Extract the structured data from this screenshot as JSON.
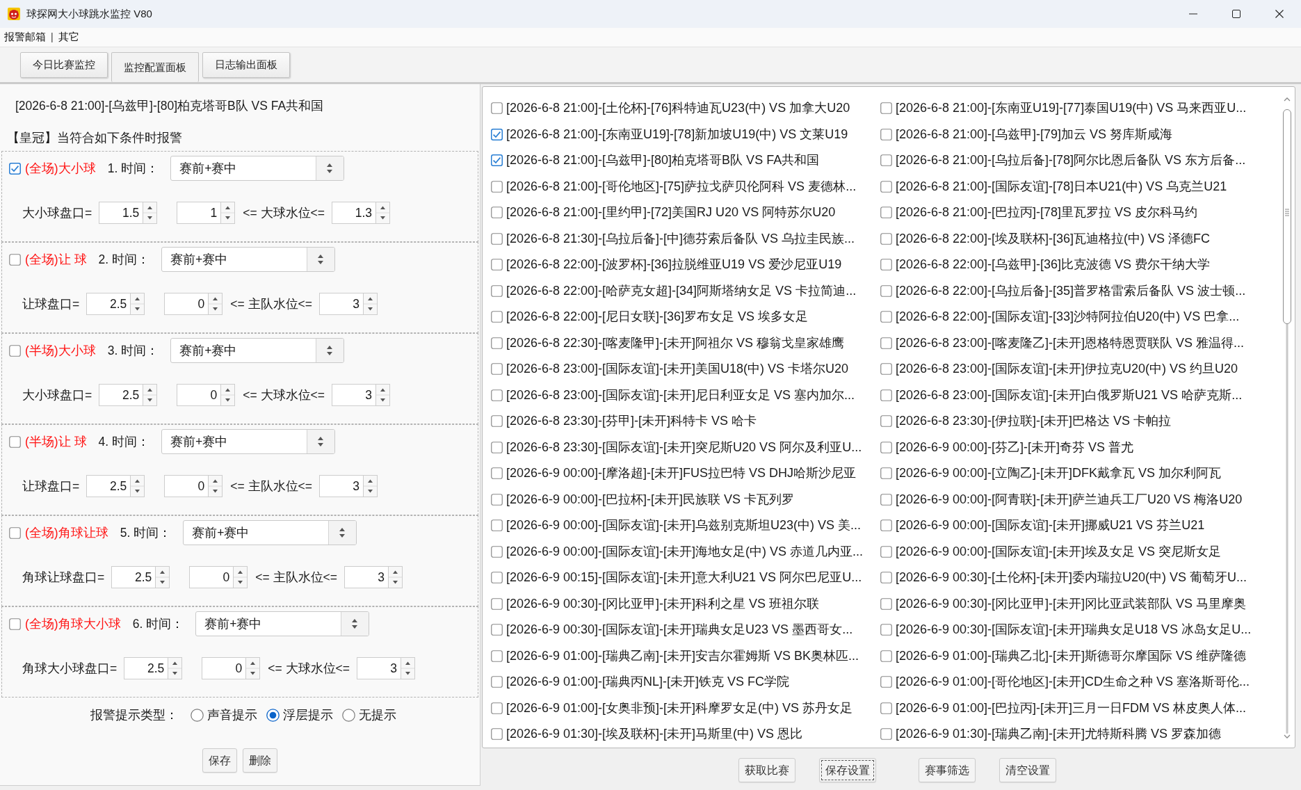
{
  "window": {
    "title": "球探网大小球跳水监控 V80"
  },
  "menu": [
    {
      "label": "报警邮箱",
      "kind": "item"
    },
    {
      "label": "|",
      "kind": "separator"
    },
    {
      "label": "其它",
      "kind": "item"
    }
  ],
  "tabs": [
    {
      "label": "今日比赛监控",
      "selected": false
    },
    {
      "label": "监控配置面板",
      "selected": true
    },
    {
      "label": "日志输出面板",
      "selected": false
    }
  ],
  "config": {
    "match": "[2026-6-8 21:00]-[乌兹甲]-[80]柏克塔哥B队 VS FA共和国",
    "heading": "【皇冠】当符合如下条件时报警",
    "rules": [
      {
        "checked": true,
        "label": "(全场)大小球",
        "time_label": "1. 时间：",
        "time_value": "赛前+赛中",
        "line_label": "大小球盘口=",
        "line_value": "1.5",
        "min_value": "1",
        "range_label": "<= 大球水位<=",
        "max_value": "1.3"
      },
      {
        "checked": false,
        "label": "(全场)让 球",
        "time_label": "2. 时间：",
        "time_value": "赛前+赛中",
        "line_label": "让球盘口=",
        "line_value": "2.5",
        "min_value": "0",
        "range_label": "<= 主队水位<=",
        "max_value": "3"
      },
      {
        "checked": false,
        "label": "(半场)大小球",
        "time_label": "3. 时间：",
        "time_value": "赛前+赛中",
        "line_label": "大小球盘口=",
        "line_value": "2.5",
        "min_value": "0",
        "range_label": "<= 大球水位<=",
        "max_value": "3"
      },
      {
        "checked": false,
        "label": "(半场)让 球",
        "time_label": "4. 时间：",
        "time_value": "赛前+赛中",
        "line_label": "让球盘口=",
        "line_value": "2.5",
        "min_value": "0",
        "range_label": "<= 主队水位<=",
        "max_value": "3"
      },
      {
        "checked": false,
        "label": "(全场)角球让球",
        "time_label": "5. 时间：",
        "time_value": "赛前+赛中",
        "line_label": "角球让球盘口=",
        "line_value": "2.5",
        "min_value": "0",
        "range_label": "<= 主队水位<=",
        "max_value": "3"
      },
      {
        "checked": false,
        "label": "(全场)角球大小球",
        "time_label": "6. 时间：",
        "time_value": "赛前+赛中",
        "line_label": "角球大小球盘口=",
        "line_value": "2.5",
        "min_value": "0",
        "range_label": "<= 大球水位<=",
        "max_value": "3"
      }
    ],
    "alert_type": {
      "label": "报警提示类型：",
      "options": [
        {
          "label": "声音提示",
          "selected": false
        },
        {
          "label": "浮层提示",
          "selected": true
        },
        {
          "label": "无提示",
          "selected": false
        }
      ]
    },
    "buttons": [
      {
        "label": "保存"
      },
      {
        "label": "删除"
      }
    ]
  },
  "matches": [
    {
      "text": "[2026-6-8 21:00]-[土伦杯]-[76]科特迪瓦U23(中) VS 加拿大U20",
      "checked": false
    },
    {
      "text": "[2026-6-8 21:00]-[东南亚U19]-[78]新加坡U19(中) VS 文莱U19",
      "checked": true
    },
    {
      "text": "[2026-6-8 21:00]-[乌兹甲]-[80]柏克塔哥B队 VS FA共和国",
      "checked": true
    },
    {
      "text": "[2026-6-8 21:00]-[哥伦地区]-[75]萨拉戈萨贝伦阿科 VS 麦德林...",
      "checked": false
    },
    {
      "text": "[2026-6-8 21:00]-[里约甲]-[72]美国RJ U20 VS 阿特苏尔U20",
      "checked": false
    },
    {
      "text": "[2026-6-8 21:30]-[乌拉后备]-[中]德芬索后备队 VS 乌拉圭民族...",
      "checked": false
    },
    {
      "text": "[2026-6-8 22:00]-[波罗杯]-[36]拉脱维亚U19 VS 爱沙尼亚U19",
      "checked": false
    },
    {
      "text": "[2026-6-8 22:00]-[哈萨克女超]-[34]阿斯塔纳女足 VS 卡拉简迪...",
      "checked": false
    },
    {
      "text": "[2026-6-8 22:00]-[尼日女联]-[36]罗布女足 VS 埃多女足",
      "checked": false
    },
    {
      "text": "[2026-6-8 22:30]-[喀麦隆甲]-[未开]阿祖尔 VS 穆翁戈皇家雄鹰",
      "checked": false
    },
    {
      "text": "[2026-6-8 23:00]-[国际友谊]-[未开]美国U18(中) VS 卡塔尔U20",
      "checked": false
    },
    {
      "text": "[2026-6-8 23:00]-[国际友谊]-[未开]尼日利亚女足 VS 塞内加尔...",
      "checked": false
    },
    {
      "text": "[2026-6-8 23:30]-[芬甲]-[未开]科特卡 VS 哈卡",
      "checked": false
    },
    {
      "text": "[2026-6-8 23:30]-[国际友谊]-[未开]突尼斯U20 VS 阿尔及利亚U...",
      "checked": false
    },
    {
      "text": "[2026-6-9 00:00]-[摩洛超]-[未开]FUS拉巴特 VS DHJ哈斯沙尼亚",
      "checked": false
    },
    {
      "text": "[2026-6-9 00:00]-[巴拉杯]-[未开]民族联 VS 卡瓦列罗",
      "checked": false
    },
    {
      "text": "[2026-6-9 00:00]-[国际友谊]-[未开]乌兹别克斯坦U23(中) VS 美...",
      "checked": false
    },
    {
      "text": "[2026-6-9 00:00]-[国际友谊]-[未开]海地女足(中) VS 赤道几内亚...",
      "checked": false
    },
    {
      "text": "[2026-6-9 00:15]-[国际友谊]-[未开]意大利U21 VS 阿尔巴尼亚U...",
      "checked": false
    },
    {
      "text": "[2026-6-9 00:30]-[冈比亚甲]-[未开]科利之星 VS 班祖尔联",
      "checked": false
    },
    {
      "text": "[2026-6-9 00:30]-[国际友谊]-[未开]瑞典女足U23 VS 墨西哥女...",
      "checked": false
    },
    {
      "text": "[2026-6-9 01:00]-[瑞典乙南]-[未开]安吉尔霍姆斯 VS BK奥林匹...",
      "checked": false
    },
    {
      "text": "[2026-6-9 01:00]-[瑞典丙NL]-[未开]铁克 VS FC学院",
      "checked": false
    },
    {
      "text": "[2026-6-9 01:00]-[女奥非预]-[未开]科摩罗女足(中) VS 苏丹女足",
      "checked": false
    },
    {
      "text": "[2026-6-9 01:30]-[埃及联杯]-[未开]马斯里(中) VS 恩比",
      "checked": false
    },
    {
      "text": "[2026-6-8 21:00]-[东南亚U19]-[77]泰国U19(中) VS 马来西亚U...",
      "checked": false
    },
    {
      "text": "[2026-6-8 21:00]-[乌兹甲]-[79]加云 VS 努库斯咸海",
      "checked": false
    },
    {
      "text": "[2026-6-8 21:00]-[乌拉后备]-[78]阿尔比恩后备队 VS 东方后备...",
      "checked": false
    },
    {
      "text": "[2026-6-8 21:00]-[国际友谊]-[78]日本U21(中) VS 乌克兰U21",
      "checked": false
    },
    {
      "text": "[2026-6-8 21:00]-[巴拉丙]-[78]里瓦罗拉 VS 皮尔科马约",
      "checked": false
    },
    {
      "text": "[2026-6-8 22:00]-[埃及联杯]-[36]瓦迪格拉(中) VS 泽德FC",
      "checked": false
    },
    {
      "text": "[2026-6-8 22:00]-[乌兹甲]-[36]比克波德 VS 费尔干纳大学",
      "checked": false
    },
    {
      "text": "[2026-6-8 22:00]-[乌拉后备]-[35]普罗格雷索后备队 VS 波士顿...",
      "checked": false
    },
    {
      "text": "[2026-6-8 22:00]-[国际友谊]-[33]沙特阿拉伯U20(中) VS 巴拿...",
      "checked": false
    },
    {
      "text": "[2026-6-8 23:00]-[喀麦隆乙]-[未开]恩格特恩贾联队 VS 雅温得...",
      "checked": false
    },
    {
      "text": "[2026-6-8 23:00]-[国际友谊]-[未开]伊拉克U20(中) VS 约旦U20",
      "checked": false
    },
    {
      "text": "[2026-6-8 23:00]-[国际友谊]-[未开]白俄罗斯U21 VS 哈萨克斯...",
      "checked": false
    },
    {
      "text": "[2026-6-8 23:30]-[伊拉联]-[未开]巴格达 VS 卡帕拉",
      "checked": false
    },
    {
      "text": "[2026-6-9 00:00]-[芬乙]-[未开]奇芬 VS 普尤",
      "checked": false
    },
    {
      "text": "[2026-6-9 00:00]-[立陶乙]-[未开]DFK戴拿瓦 VS 加尔利阿瓦",
      "checked": false
    },
    {
      "text": "[2026-6-9 00:00]-[阿青联]-[未开]萨兰迪兵工厂U20 VS 梅洛U20",
      "checked": false
    },
    {
      "text": "[2026-6-9 00:00]-[国际友谊]-[未开]挪威U21 VS 芬兰U21",
      "checked": false
    },
    {
      "text": "[2026-6-9 00:00]-[国际友谊]-[未开]埃及女足 VS 突尼斯女足",
      "checked": false
    },
    {
      "text": "[2026-6-9 00:30]-[土伦杯]-[未开]委内瑞拉U20(中) VS 葡萄牙U...",
      "checked": false
    },
    {
      "text": "[2026-6-9 00:30]-[冈比亚甲]-[未开]冈比亚武装部队 VS 马里摩奥",
      "checked": false
    },
    {
      "text": "[2026-6-9 00:30]-[国际友谊]-[未开]瑞典女足U18 VS 冰岛女足U...",
      "checked": false
    },
    {
      "text": "[2026-6-9 01:00]-[瑞典乙北]-[未开]斯德哥尔摩国际 VS 维萨隆德",
      "checked": false
    },
    {
      "text": "[2026-6-9 01:00]-[哥伦地区]-[未开]CD生命之种 VS 塞洛斯哥伦...",
      "checked": false
    },
    {
      "text": "[2026-6-9 01:00]-[巴拉丙]-[未开]三月一日FDM VS 林皮奥人体...",
      "checked": false
    },
    {
      "text": "[2026-6-9 01:30]-[瑞典乙南]-[未开]尤特斯科腾 VS 罗森加德",
      "checked": false
    }
  ],
  "actions": [
    {
      "label": "获取比赛",
      "focused": false
    },
    {
      "label": "保存设置",
      "focused": true
    },
    {
      "label": "赛事筛选",
      "focused": false
    },
    {
      "label": "清空设置",
      "focused": false
    }
  ]
}
